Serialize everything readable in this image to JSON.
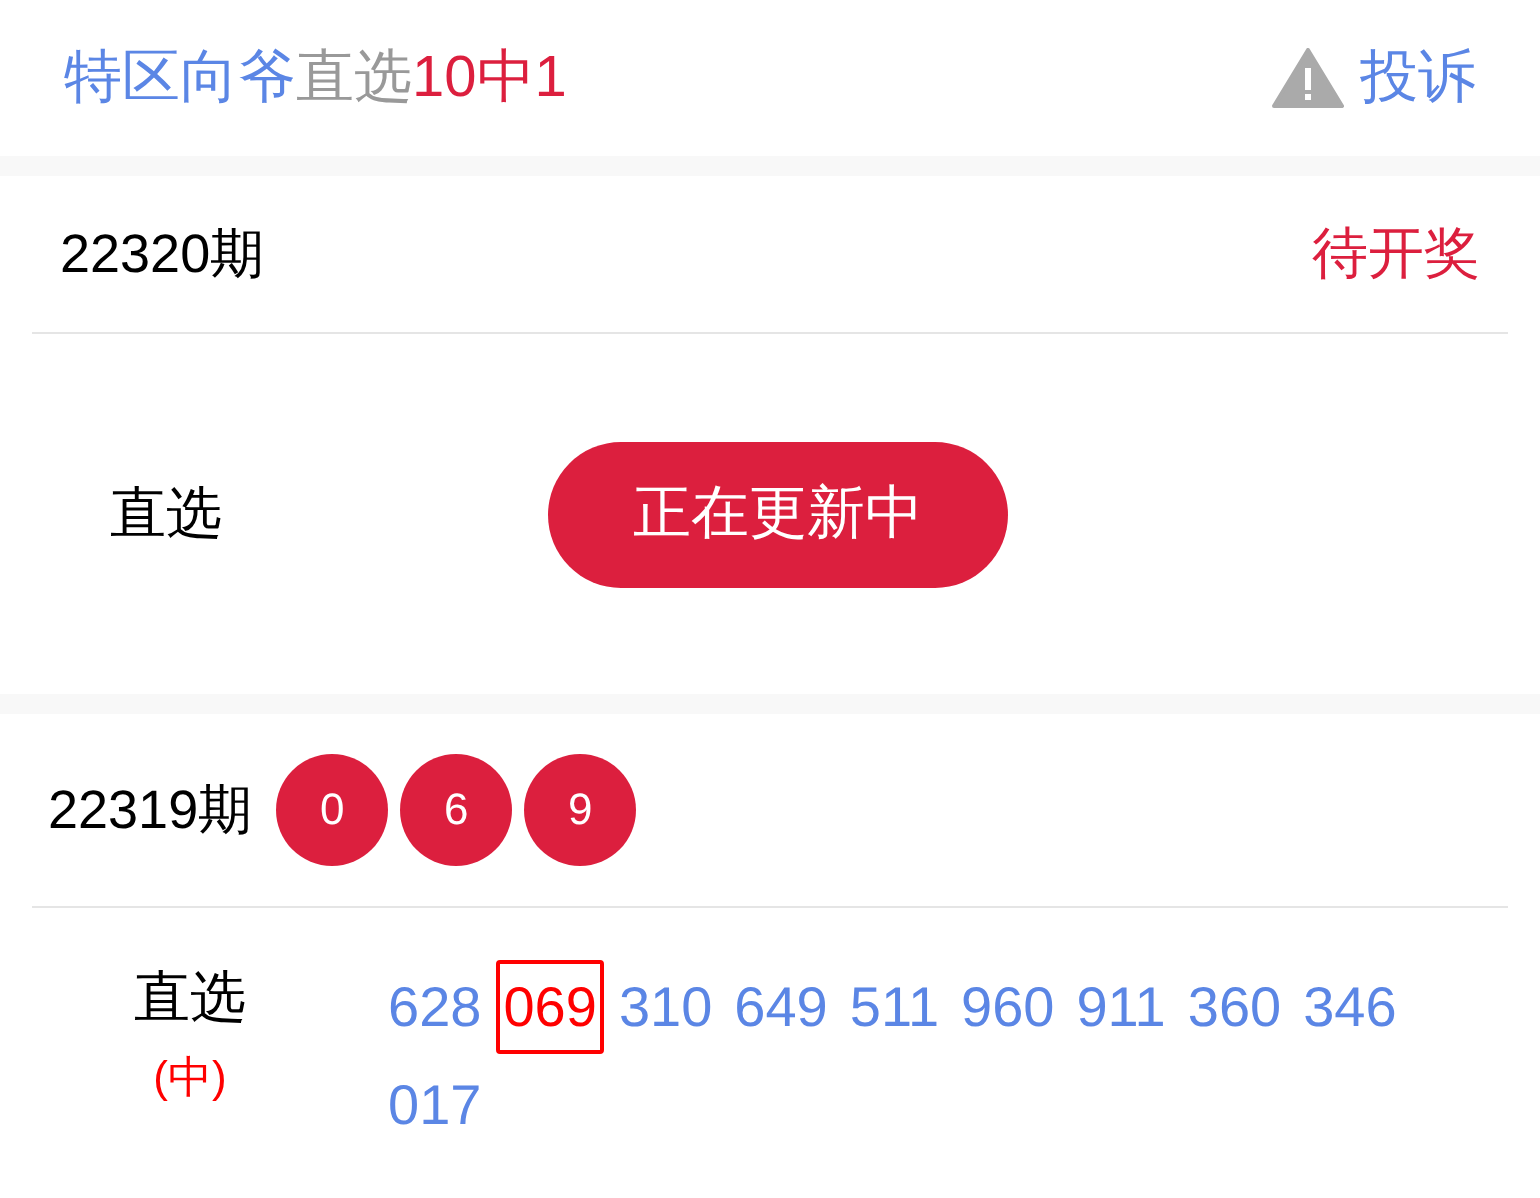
{
  "header": {
    "title_parts": [
      {
        "text": "特区向爷",
        "color": "#5b86e5"
      },
      {
        "text": "直选",
        "color": "#999999"
      },
      {
        "text": "10中1",
        "color": "#dc1f3e"
      }
    ],
    "complaint": "投诉"
  },
  "current": {
    "issue": "22320期",
    "status": "待开奖",
    "label": "直选",
    "button": "正在更新中"
  },
  "previous": {
    "issue": "22319期",
    "balls": [
      "0",
      "6",
      "9"
    ],
    "label": "直选",
    "result": "(中)",
    "picks": [
      {
        "text": "628",
        "selected": false
      },
      {
        "text": "069",
        "selected": true
      },
      {
        "text": "310",
        "selected": false
      },
      {
        "text": "649",
        "selected": false
      },
      {
        "text": "511",
        "selected": false
      },
      {
        "text": "960",
        "selected": false
      },
      {
        "text": "911",
        "selected": false
      },
      {
        "text": "360",
        "selected": false
      },
      {
        "text": "346",
        "selected": false
      },
      {
        "text": "017",
        "selected": false
      }
    ]
  }
}
